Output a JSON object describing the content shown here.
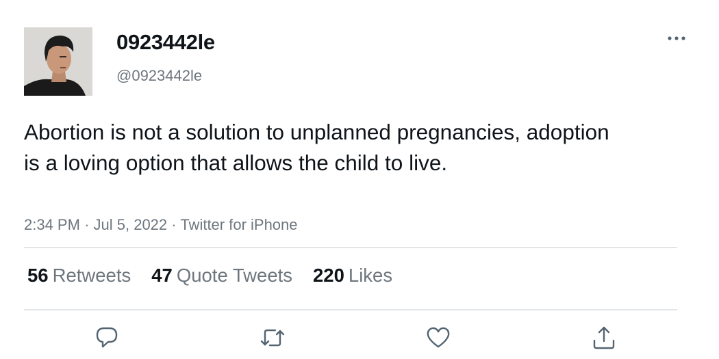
{
  "author": {
    "display_name": "0923442le",
    "handle": "@0923442le",
    "avatar_icon": "profile-photo"
  },
  "tweet": {
    "text": "Abortion is not a solution to unplanned pregnancies, adoption is a loving option that allows the child to live.",
    "time": "2:34 PM",
    "date": "Jul 5, 2022",
    "source": "Twitter for iPhone",
    "separator": "·"
  },
  "stats": {
    "retweets_count": "56",
    "retweets_label": "Retweets",
    "quote_tweets_count": "47",
    "quote_tweets_label": "Quote Tweets",
    "likes_count": "220",
    "likes_label": "Likes"
  },
  "actions": [
    "reply-icon",
    "retweet-icon",
    "like-icon",
    "share-icon"
  ],
  "colors": {
    "text": "#0f1419",
    "secondary": "#6e767d",
    "divider": "#e1e5e8",
    "icon": "#536471"
  }
}
